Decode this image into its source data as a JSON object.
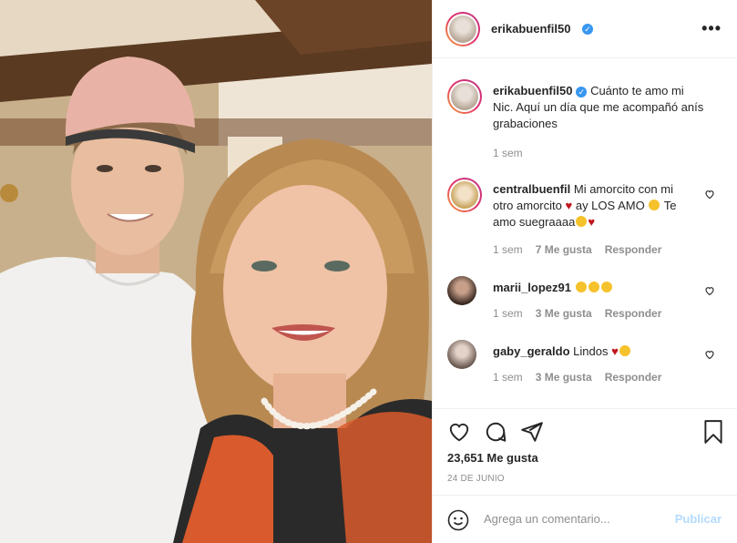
{
  "post": {
    "author": "erikabuenfil50",
    "caption": "Cuánto te amo mi Nic. Aquí un día que me acompañó anís grabaciones",
    "caption_time": "1 sem",
    "likes": "23,651 Me gusta",
    "date": "24 DE JUNIO",
    "more_label": "•••"
  },
  "comments": [
    {
      "user": "centralbuenfil",
      "text_parts": [
        "Mi amorcito con mi otro amorcito",
        "heart",
        "ay LOS AMO",
        "smile",
        "Te amo suegraaaa",
        "laugh",
        "heart"
      ],
      "time": "1 sem",
      "likes": "7 Me gusta",
      "reply": "Responder"
    },
    {
      "user": "marii_lopez91",
      "text_parts": [
        "smile",
        "smile",
        "smile"
      ],
      "time": "1 sem",
      "likes": "3 Me gusta",
      "reply": "Responder"
    },
    {
      "user": "gaby_geraldo",
      "text_parts": [
        "Lindos",
        "heart",
        "smile"
      ],
      "time": "1 sem",
      "likes": "3 Me gusta",
      "reply": "Responder"
    }
  ],
  "add_comment": {
    "placeholder": "Agrega un comentario...",
    "publish": "Publicar"
  },
  "colors": {
    "verified": "#3897f0",
    "publish_disabled": "#b3dbff",
    "meta": "#8e8e8e"
  },
  "icons": [
    "more-icon",
    "verified-icon",
    "like-heart-icon",
    "comment-icon",
    "share-icon",
    "save-icon",
    "emoji-icon"
  ]
}
